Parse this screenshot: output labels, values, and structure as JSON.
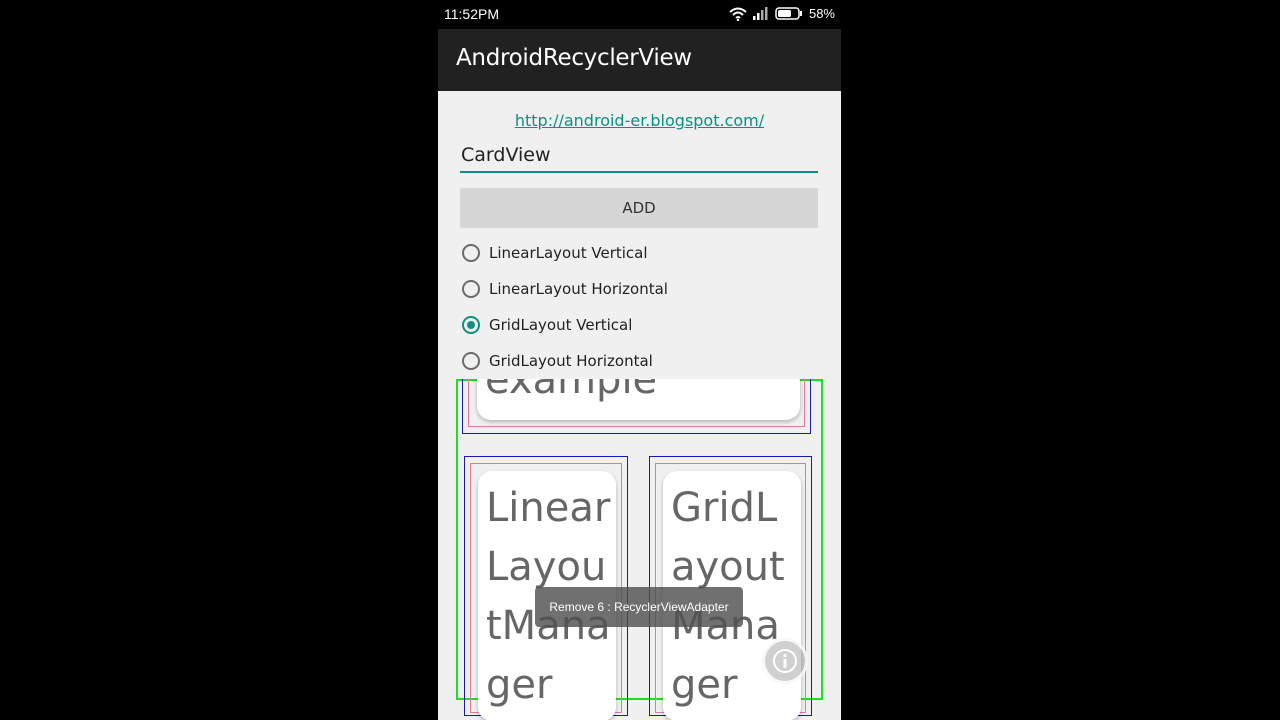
{
  "status": {
    "time": "11:52PM",
    "battery": "58%"
  },
  "app": {
    "title": "AndroidRecyclerView"
  },
  "form": {
    "link": "http://android-er.blogspot.com/",
    "input_value": "CardView",
    "add_label": "ADD",
    "radio": [
      {
        "label": "LinearLayout Vertical",
        "checked": false
      },
      {
        "label": "LinearLayout Horizontal",
        "checked": false
      },
      {
        "label": "GridLayout Vertical",
        "checked": true
      },
      {
        "label": "GridLayout Horizontal",
        "checked": false
      }
    ]
  },
  "cards": {
    "top": "example",
    "left": "LinearLayoutManager",
    "right": "GridLayoutManager"
  },
  "toast": "Remove 6 : RecyclerViewAdapter",
  "colors": {
    "accent": "#0f8f83",
    "app_bar": "#212121",
    "frame": "#22dd22"
  }
}
